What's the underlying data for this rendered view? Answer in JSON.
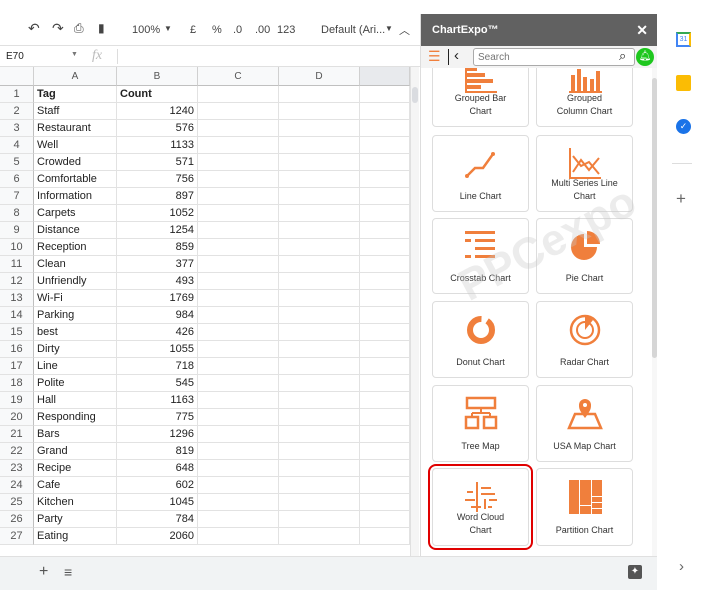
{
  "toolbar": {
    "zoom": "100%",
    "currency": "£",
    "percent": "%",
    "dec_less": ".0",
    "dec_more": ".00",
    "format": "123",
    "font": "Default (Ari..."
  },
  "namebox": "E70",
  "fx": "fx",
  "columns": [
    "A",
    "B",
    "C",
    "D"
  ],
  "rows": [
    [
      "1",
      "Tag",
      "Count"
    ],
    [
      "2",
      "Staff",
      "1240"
    ],
    [
      "3",
      "Restaurant",
      "576"
    ],
    [
      "4",
      "Well",
      "1133"
    ],
    [
      "5",
      "Crowded",
      "571"
    ],
    [
      "6",
      "Comfortable",
      "756"
    ],
    [
      "7",
      "Information",
      "897"
    ],
    [
      "8",
      "Carpets",
      "1052"
    ],
    [
      "9",
      "Distance",
      "1254"
    ],
    [
      "10",
      "Reception",
      "859"
    ],
    [
      "11",
      "Clean",
      "377"
    ],
    [
      "12",
      "Unfriendly",
      "493"
    ],
    [
      "13",
      "Wi-Fi",
      "1769"
    ],
    [
      "14",
      "Parking",
      "984"
    ],
    [
      "15",
      "best",
      "426"
    ],
    [
      "16",
      "Dirty",
      "1055"
    ],
    [
      "17",
      "Line",
      "718"
    ],
    [
      "18",
      "Polite",
      "545"
    ],
    [
      "19",
      "Hall",
      "1163"
    ],
    [
      "20",
      "Responding",
      "775"
    ],
    [
      "21",
      "Bars",
      "1296"
    ],
    [
      "22",
      "Grand",
      "819"
    ],
    [
      "23",
      "Recipe",
      "648"
    ],
    [
      "24",
      "Cafe",
      "602"
    ],
    [
      "25",
      "Kitchen",
      "1045"
    ],
    [
      "26",
      "Party",
      "784"
    ],
    [
      "27",
      "Eating",
      "2060"
    ]
  ],
  "panel": {
    "title": "ChartExpo™",
    "search_placeholder": "Search",
    "watermark": "PPCexpo",
    "accent": "#f07f3c",
    "selected_color": "#e00000",
    "cards": [
      {
        "label": "Grouped Bar Chart",
        "icon": "grouped-bar-icon"
      },
      {
        "label": "Grouped Column Chart",
        "icon": "grouped-column-icon"
      },
      {
        "label": "Line Chart",
        "icon": "line-chart-icon"
      },
      {
        "label": "Multi Series Line Chart",
        "icon": "multi-line-icon"
      },
      {
        "label": "Crosstab Chart",
        "icon": "crosstab-icon"
      },
      {
        "label": "Pie Chart",
        "icon": "pie-icon"
      },
      {
        "label": "Donut Chart",
        "icon": "donut-icon"
      },
      {
        "label": "Radar Chart",
        "icon": "radar-icon"
      },
      {
        "label": "Tree Map",
        "icon": "tree-map-icon"
      },
      {
        "label": "USA Map Chart",
        "icon": "usa-map-icon"
      },
      {
        "label": "Word Cloud Chart",
        "icon": "word-cloud-icon",
        "selected": true
      },
      {
        "label": "Partition Chart",
        "icon": "partition-icon"
      }
    ]
  }
}
